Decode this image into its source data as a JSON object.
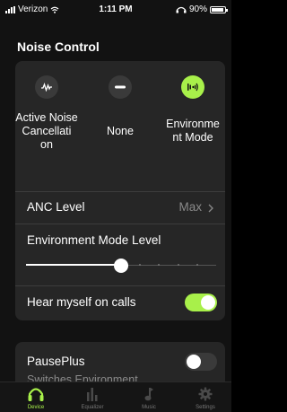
{
  "status_bar": {
    "carrier": "Verizon",
    "time": "1:11 PM",
    "battery": "90%",
    "battery_level": 0.9
  },
  "noise_control": {
    "title": "Noise Control",
    "modes": [
      {
        "label": "Active Noise Cancellati on",
        "icon": "anc-waveform-icon",
        "selected": false
      },
      {
        "label": "None",
        "icon": "minus-icon",
        "selected": false
      },
      {
        "label": "Environme nt Mode",
        "icon": "environment-sound-icon",
        "selected": true
      }
    ],
    "anc_level": {
      "label": "ANC Level",
      "value": "Max"
    },
    "environment_mode_level": {
      "label": "Environment Mode Level",
      "level": 0.5,
      "ticks": 5
    },
    "hear_myself": {
      "label": "Hear myself on calls",
      "on": true
    }
  },
  "pauseplus": {
    "title": "PausePlus",
    "subtitle": "Switches Environment",
    "on": false
  },
  "tabs": [
    {
      "label": "Device",
      "icon": "headphones-icon",
      "active": true
    },
    {
      "label": "Equalizer",
      "icon": "equalizer-icon",
      "active": false
    },
    {
      "label": "Music",
      "icon": "music-note-icon",
      "active": false
    },
    {
      "label": "Settings",
      "icon": "gear-icon",
      "active": false
    }
  ],
  "colors": {
    "accent": "#a8f04a",
    "card": "#262626",
    "background": "#121212"
  }
}
